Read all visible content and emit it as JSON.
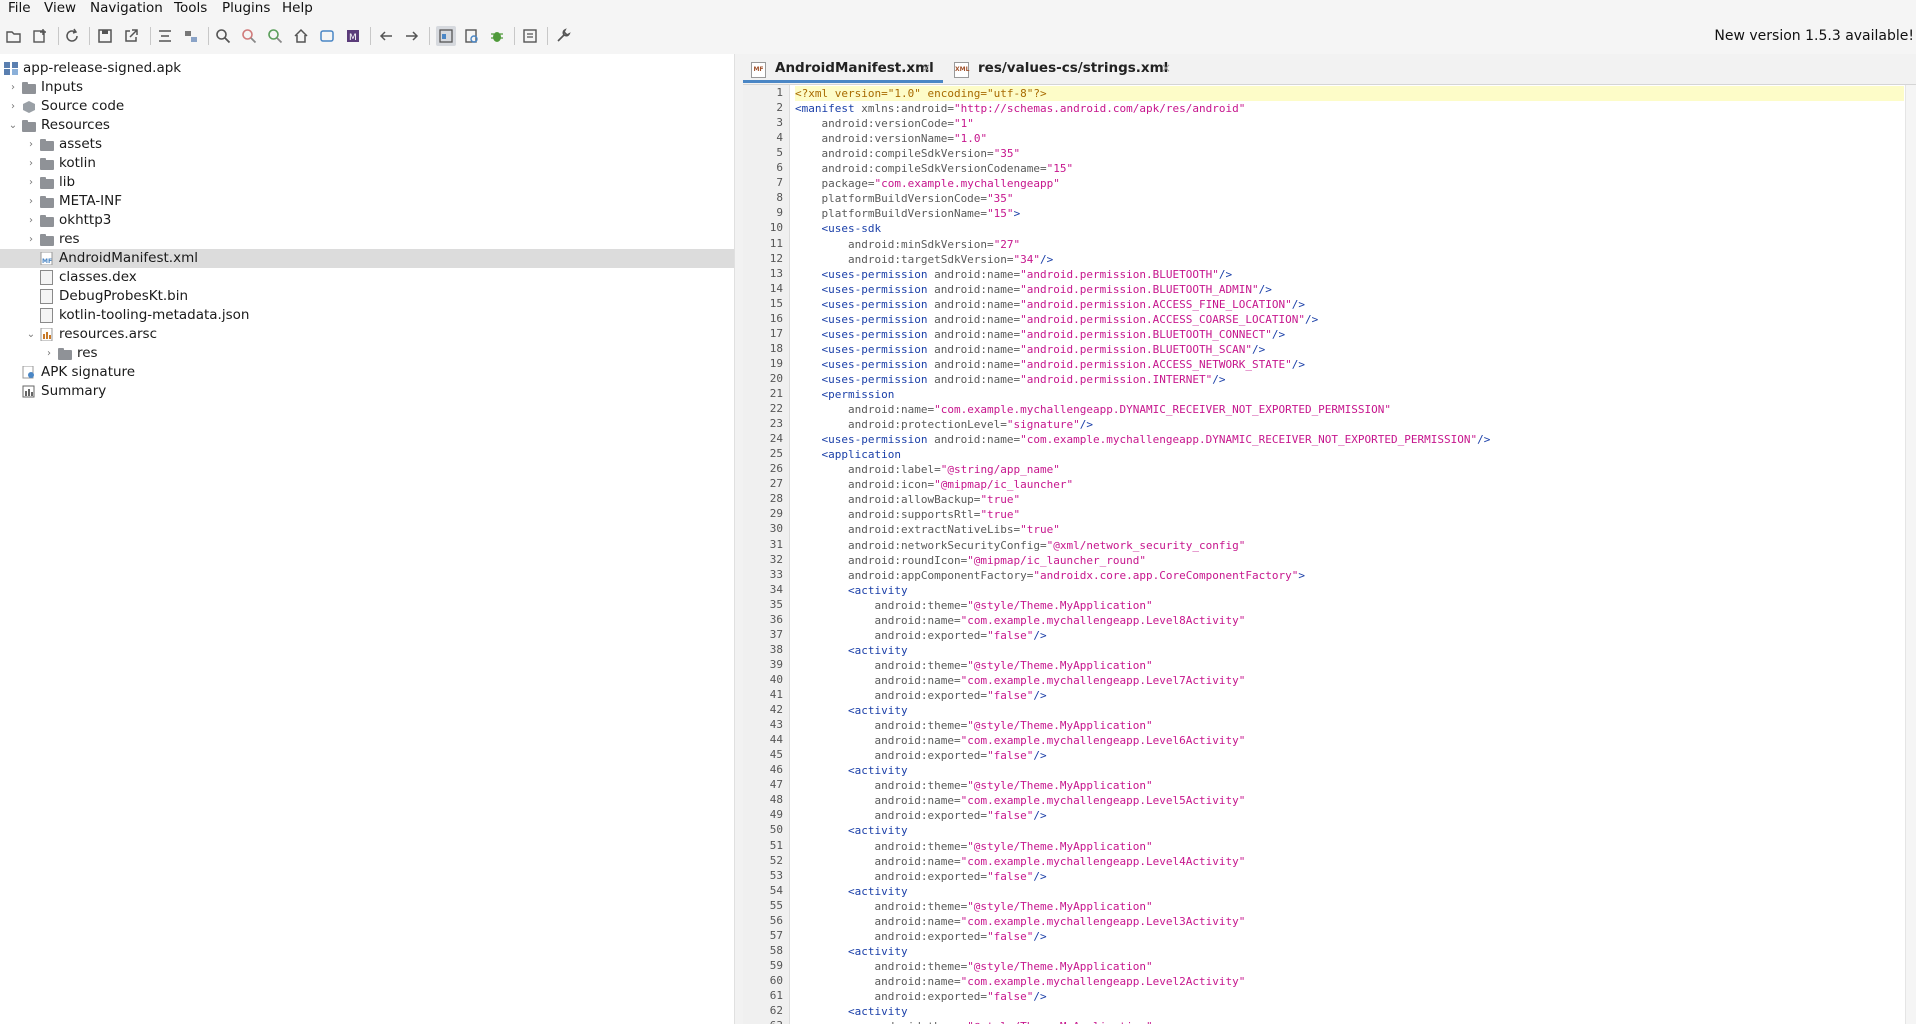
{
  "menu": [
    "File",
    "View",
    "Navigation",
    "Tools",
    "Plugins",
    "Help"
  ],
  "notice": "New version 1.5.3 available!",
  "tree": [
    {
      "label": "app-release-signed.apk",
      "indent": 0,
      "arrow": "",
      "icon": "apk-icon"
    },
    {
      "label": "Inputs",
      "indent": 1,
      "arrow": "›",
      "icon": "folder-icon"
    },
    {
      "label": "Source code",
      "indent": 1,
      "arrow": "›",
      "icon": "package-icon"
    },
    {
      "label": "Resources",
      "indent": 1,
      "arrow": "⌄",
      "icon": "folder-icon"
    },
    {
      "label": "assets",
      "indent": 2,
      "arrow": "›",
      "icon": "folder-icon"
    },
    {
      "label": "kotlin",
      "indent": 2,
      "arrow": "›",
      "icon": "folder-icon"
    },
    {
      "label": "lib",
      "indent": 2,
      "arrow": "›",
      "icon": "folder-icon"
    },
    {
      "label": "META-INF",
      "indent": 2,
      "arrow": "›",
      "icon": "folder-icon"
    },
    {
      "label": "okhttp3",
      "indent": 2,
      "arrow": "›",
      "icon": "folder-icon"
    },
    {
      "label": "res",
      "indent": 2,
      "arrow": "›",
      "icon": "folder-icon"
    },
    {
      "label": "AndroidManifest.xml",
      "indent": 2,
      "arrow": "",
      "icon": "manifest-icon",
      "selected": true
    },
    {
      "label": "classes.dex",
      "indent": 2,
      "arrow": "",
      "icon": "file-icon"
    },
    {
      "label": "DebugProbesKt.bin",
      "indent": 2,
      "arrow": "",
      "icon": "file-icon"
    },
    {
      "label": "kotlin-tooling-metadata.json",
      "indent": 2,
      "arrow": "",
      "icon": "file-icon"
    },
    {
      "label": "resources.arsc",
      "indent": 2,
      "arrow": "⌄",
      "icon": "arsc-icon"
    },
    {
      "label": "res",
      "indent": 3,
      "arrow": "›",
      "icon": "folder-icon"
    },
    {
      "label": "APK signature",
      "indent": 1,
      "arrow": "",
      "icon": "signature-icon"
    },
    {
      "label": "Summary",
      "indent": 1,
      "arrow": "",
      "icon": "summary-icon"
    }
  ],
  "tabs": [
    {
      "label": "AndroidManifest.xml",
      "icon_text": "MF",
      "active": true
    },
    {
      "label": "res/values-cs/strings.xml",
      "icon_text": "XML",
      "active": false
    }
  ],
  "close_glyph": "×",
  "code_lines": [
    [
      [
        "decl",
        "<?xml version=\"1.0\" encoding=\"utf-8\"?>"
      ]
    ],
    [
      [
        "tag",
        "<manifest"
      ],
      [
        "att",
        " xmlns:android="
      ],
      [
        "val",
        "\"http://schemas.android.com/apk/res/android\""
      ]
    ],
    [
      [
        "att",
        "    android:versionCode="
      ],
      [
        "val",
        "\"1\""
      ]
    ],
    [
      [
        "att",
        "    android:versionName="
      ],
      [
        "val",
        "\"1.0\""
      ]
    ],
    [
      [
        "att",
        "    android:compileSdkVersion="
      ],
      [
        "val",
        "\"35\""
      ]
    ],
    [
      [
        "att",
        "    android:compileSdkVersionCodename="
      ],
      [
        "val",
        "\"15\""
      ]
    ],
    [
      [
        "att",
        "    package="
      ],
      [
        "val",
        "\"com.example.mychallengeapp\""
      ]
    ],
    [
      [
        "att",
        "    platformBuildVersionCode="
      ],
      [
        "val",
        "\"35\""
      ]
    ],
    [
      [
        "att",
        "    platformBuildVersionName="
      ],
      [
        "val",
        "\"15\""
      ],
      [
        "tag",
        ">"
      ]
    ],
    [
      [
        "tag",
        "    <uses-sdk"
      ]
    ],
    [
      [
        "att",
        "        android:minSdkVersion="
      ],
      [
        "val",
        "\"27\""
      ]
    ],
    [
      [
        "att",
        "        android:targetSdkVersion="
      ],
      [
        "val",
        "\"34\""
      ],
      [
        "tag",
        "/>"
      ]
    ],
    [
      [
        "tag",
        "    <uses-permission"
      ],
      [
        "att",
        " android:name="
      ],
      [
        "val",
        "\"android.permission.BLUETOOTH\""
      ],
      [
        "tag",
        "/>"
      ]
    ],
    [
      [
        "tag",
        "    <uses-permission"
      ],
      [
        "att",
        " android:name="
      ],
      [
        "val",
        "\"android.permission.BLUETOOTH_ADMIN\""
      ],
      [
        "tag",
        "/>"
      ]
    ],
    [
      [
        "tag",
        "    <uses-permission"
      ],
      [
        "att",
        " android:name="
      ],
      [
        "val",
        "\"android.permission.ACCESS_FINE_LOCATION\""
      ],
      [
        "tag",
        "/>"
      ]
    ],
    [
      [
        "tag",
        "    <uses-permission"
      ],
      [
        "att",
        " android:name="
      ],
      [
        "val",
        "\"android.permission.ACCESS_COARSE_LOCATION\""
      ],
      [
        "tag",
        "/>"
      ]
    ],
    [
      [
        "tag",
        "    <uses-permission"
      ],
      [
        "att",
        " android:name="
      ],
      [
        "val",
        "\"android.permission.BLUETOOTH_CONNECT\""
      ],
      [
        "tag",
        "/>"
      ]
    ],
    [
      [
        "tag",
        "    <uses-permission"
      ],
      [
        "att",
        " android:name="
      ],
      [
        "val",
        "\"android.permission.BLUETOOTH_SCAN\""
      ],
      [
        "tag",
        "/>"
      ]
    ],
    [
      [
        "tag",
        "    <uses-permission"
      ],
      [
        "att",
        " android:name="
      ],
      [
        "val",
        "\"android.permission.ACCESS_NETWORK_STATE\""
      ],
      [
        "tag",
        "/>"
      ]
    ],
    [
      [
        "tag",
        "    <uses-permission"
      ],
      [
        "att",
        " android:name="
      ],
      [
        "val",
        "\"android.permission.INTERNET\""
      ],
      [
        "tag",
        "/>"
      ]
    ],
    [
      [
        "tag",
        "    <permission"
      ]
    ],
    [
      [
        "att",
        "        android:name="
      ],
      [
        "val",
        "\"com.example.mychallengeapp.DYNAMIC_RECEIVER_NOT_EXPORTED_PERMISSION\""
      ]
    ],
    [
      [
        "att",
        "        android:protectionLevel="
      ],
      [
        "val",
        "\"signature\""
      ],
      [
        "tag",
        "/>"
      ]
    ],
    [
      [
        "tag",
        "    <uses-permission"
      ],
      [
        "att",
        " android:name="
      ],
      [
        "val",
        "\"com.example.mychallengeapp.DYNAMIC_RECEIVER_NOT_EXPORTED_PERMISSION\""
      ],
      [
        "tag",
        "/>"
      ]
    ],
    [
      [
        "tag",
        "    <application"
      ]
    ],
    [
      [
        "att",
        "        android:label="
      ],
      [
        "val",
        "\"@string/app_name\""
      ]
    ],
    [
      [
        "att",
        "        android:icon="
      ],
      [
        "val",
        "\"@mipmap/ic_launcher\""
      ]
    ],
    [
      [
        "att",
        "        android:allowBackup="
      ],
      [
        "val",
        "\"true\""
      ]
    ],
    [
      [
        "att",
        "        android:supportsRtl="
      ],
      [
        "val",
        "\"true\""
      ]
    ],
    [
      [
        "att",
        "        android:extractNativeLibs="
      ],
      [
        "val",
        "\"true\""
      ]
    ],
    [
      [
        "att",
        "        android:networkSecurityConfig="
      ],
      [
        "val",
        "\"@xml/network_security_config\""
      ]
    ],
    [
      [
        "att",
        "        android:roundIcon="
      ],
      [
        "val",
        "\"@mipmap/ic_launcher_round\""
      ]
    ],
    [
      [
        "att",
        "        android:appComponentFactory="
      ],
      [
        "val",
        "\"androidx.core.app.CoreComponentFactory\""
      ],
      [
        "tag",
        ">"
      ]
    ],
    [
      [
        "tag",
        "        <activity"
      ]
    ],
    [
      [
        "att",
        "            android:theme="
      ],
      [
        "val",
        "\"@style/Theme.MyApplication\""
      ]
    ],
    [
      [
        "att",
        "            android:name="
      ],
      [
        "val",
        "\"com.example.mychallengeapp.Level8Activity\""
      ]
    ],
    [
      [
        "att",
        "            android:exported="
      ],
      [
        "val",
        "\"false\""
      ],
      [
        "tag",
        "/>"
      ]
    ],
    [
      [
        "tag",
        "        <activity"
      ]
    ],
    [
      [
        "att",
        "            android:theme="
      ],
      [
        "val",
        "\"@style/Theme.MyApplication\""
      ]
    ],
    [
      [
        "att",
        "            android:name="
      ],
      [
        "val",
        "\"com.example.mychallengeapp.Level7Activity\""
      ]
    ],
    [
      [
        "att",
        "            android:exported="
      ],
      [
        "val",
        "\"false\""
      ],
      [
        "tag",
        "/>"
      ]
    ],
    [
      [
        "tag",
        "        <activity"
      ]
    ],
    [
      [
        "att",
        "            android:theme="
      ],
      [
        "val",
        "\"@style/Theme.MyApplication\""
      ]
    ],
    [
      [
        "att",
        "            android:name="
      ],
      [
        "val",
        "\"com.example.mychallengeapp.Level6Activity\""
      ]
    ],
    [
      [
        "att",
        "            android:exported="
      ],
      [
        "val",
        "\"false\""
      ],
      [
        "tag",
        "/>"
      ]
    ],
    [
      [
        "tag",
        "        <activity"
      ]
    ],
    [
      [
        "att",
        "            android:theme="
      ],
      [
        "val",
        "\"@style/Theme.MyApplication\""
      ]
    ],
    [
      [
        "att",
        "            android:name="
      ],
      [
        "val",
        "\"com.example.mychallengeapp.Level5Activity\""
      ]
    ],
    [
      [
        "att",
        "            android:exported="
      ],
      [
        "val",
        "\"false\""
      ],
      [
        "tag",
        "/>"
      ]
    ],
    [
      [
        "tag",
        "        <activity"
      ]
    ],
    [
      [
        "att",
        "            android:theme="
      ],
      [
        "val",
        "\"@style/Theme.MyApplication\""
      ]
    ],
    [
      [
        "att",
        "            android:name="
      ],
      [
        "val",
        "\"com.example.mychallengeapp.Level4Activity\""
      ]
    ],
    [
      [
        "att",
        "            android:exported="
      ],
      [
        "val",
        "\"false\""
      ],
      [
        "tag",
        "/>"
      ]
    ],
    [
      [
        "tag",
        "        <activity"
      ]
    ],
    [
      [
        "att",
        "            android:theme="
      ],
      [
        "val",
        "\"@style/Theme.MyApplication\""
      ]
    ],
    [
      [
        "att",
        "            android:name="
      ],
      [
        "val",
        "\"com.example.mychallengeapp.Level3Activity\""
      ]
    ],
    [
      [
        "att",
        "            android:exported="
      ],
      [
        "val",
        "\"false\""
      ],
      [
        "tag",
        "/>"
      ]
    ],
    [
      [
        "tag",
        "        <activity"
      ]
    ],
    [
      [
        "att",
        "            android:theme="
      ],
      [
        "val",
        "\"@style/Theme.MyApplication\""
      ]
    ],
    [
      [
        "att",
        "            android:name="
      ],
      [
        "val",
        "\"com.example.mychallengeapp.Level2Activity\""
      ]
    ],
    [
      [
        "att",
        "            android:exported="
      ],
      [
        "val",
        "\"false\""
      ],
      [
        "tag",
        "/>"
      ]
    ],
    [
      [
        "tag",
        "        <activity"
      ]
    ],
    [
      [
        "att",
        "            android:theme="
      ],
      [
        "val",
        "\"@style/Theme.MyApplication\""
      ]
    ]
  ]
}
